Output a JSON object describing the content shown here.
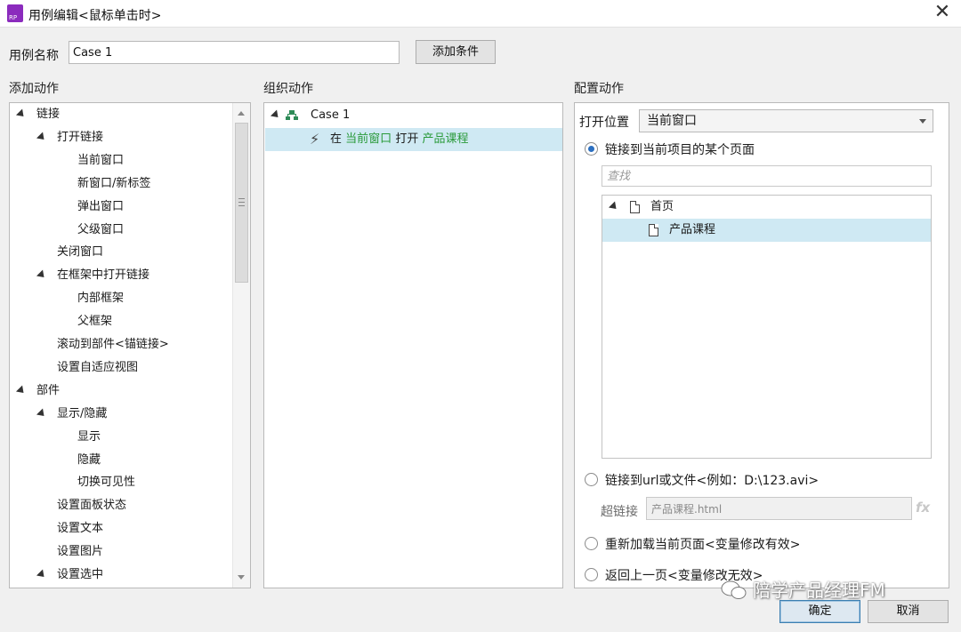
{
  "window": {
    "title": "用例编辑<鼠标单击时>",
    "close_glyph": "✕"
  },
  "case_name": {
    "label": "用例名称",
    "value": "Case 1"
  },
  "add_condition_label": "添加条件",
  "sections": {
    "add_actions": "添加动作",
    "organize_actions": "组织动作",
    "configure_actions": "配置动作"
  },
  "action_tree": [
    {
      "label": "链接",
      "level": 0,
      "expanded": true
    },
    {
      "label": "打开链接",
      "level": 1,
      "expanded": true
    },
    {
      "label": "当前窗口",
      "level": 2
    },
    {
      "label": "新窗口/新标签",
      "level": 2
    },
    {
      "label": "弹出窗口",
      "level": 2
    },
    {
      "label": "父级窗口",
      "level": 2
    },
    {
      "label": "关闭窗口",
      "level": 1
    },
    {
      "label": "在框架中打开链接",
      "level": 1,
      "expanded": true
    },
    {
      "label": "内部框架",
      "level": 2
    },
    {
      "label": "父框架",
      "level": 2
    },
    {
      "label": "滚动到部件<锚链接>",
      "level": 1
    },
    {
      "label": "设置自适应视图",
      "level": 1
    },
    {
      "label": "部件",
      "level": 0,
      "expanded": true
    },
    {
      "label": "显示/隐藏",
      "level": 1,
      "expanded": true
    },
    {
      "label": "显示",
      "level": 2
    },
    {
      "label": "隐藏",
      "level": 2
    },
    {
      "label": "切换可见性",
      "level": 2
    },
    {
      "label": "设置面板状态",
      "level": 1
    },
    {
      "label": "设置文本",
      "level": 1
    },
    {
      "label": "设置图片",
      "level": 1
    },
    {
      "label": "设置选中",
      "level": 1,
      "expanded": true
    }
  ],
  "organize": {
    "case_label": "Case 1",
    "action": {
      "prefix": "在",
      "target": "当前窗口",
      "verb": "打开",
      "page": "产品课程"
    }
  },
  "config": {
    "open_in_label": "打开位置",
    "open_in_value": "当前窗口",
    "option_link_page": "链接到当前项目的某个页面",
    "search_placeholder": "查找",
    "pages": [
      {
        "label": "首页",
        "level": 0,
        "expanded": true
      },
      {
        "label": "产品课程",
        "level": 1,
        "selected": true
      }
    ],
    "option_link_url": "链接到url或文件<例如：D:\\123.avi>",
    "hyperlink_label": "超链接",
    "hyperlink_value": "产品课程.html",
    "fx_label": "fx",
    "option_reload": "重新加载当前页面<变量修改有效>",
    "option_back": "返回上一页<变量修改无效>"
  },
  "buttons": {
    "ok": "确定",
    "cancel": "取消"
  },
  "watermark": "陪学产品经理FM",
  "colors": {
    "selection": "#cfe9f3",
    "accent_green": "#2a9a3a",
    "app_icon": "#8b2bbd",
    "radio_checked": "#2b6fc0"
  }
}
